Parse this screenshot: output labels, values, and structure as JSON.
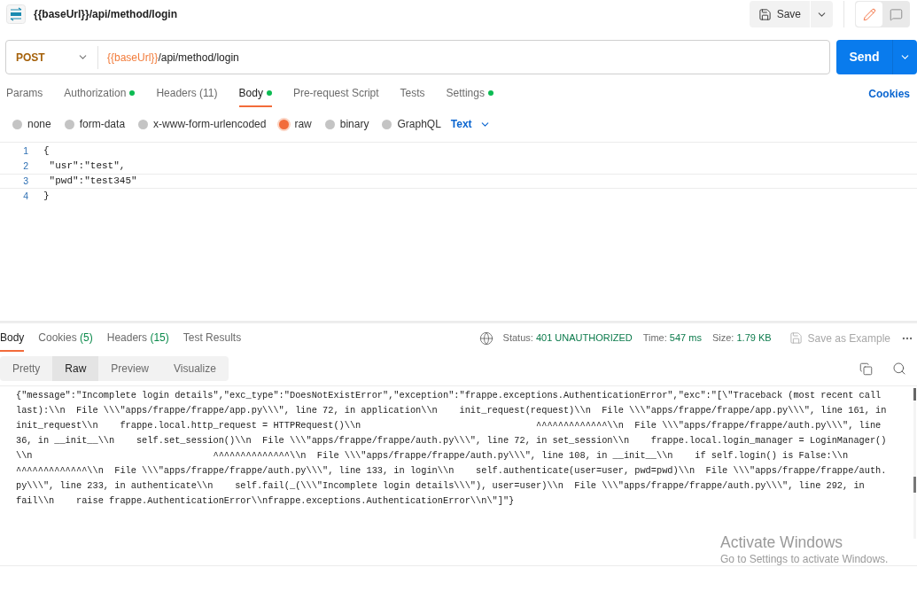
{
  "header": {
    "title": "{{baseUrl}}/api/method/login",
    "save_label": "Save",
    "modes": [
      {
        "kind": "edit",
        "selected": true
      },
      {
        "kind": "comments",
        "selected": false
      }
    ]
  },
  "request": {
    "method": "POST",
    "url_variable": "{{baseUrl}}",
    "url_path": "/api/method/login",
    "send_label": "Send"
  },
  "request_tabs": [
    {
      "label": "Params",
      "selected": false,
      "dot": false
    },
    {
      "label": "Authorization",
      "selected": false,
      "dot": true
    },
    {
      "label": "Headers (11)",
      "selected": false,
      "dot": false
    },
    {
      "label": "Body",
      "selected": true,
      "dot": true
    },
    {
      "label": "Pre-request Script",
      "selected": false,
      "dot": false
    },
    {
      "label": "Tests",
      "selected": false,
      "dot": false
    },
    {
      "label": "Settings",
      "selected": false,
      "dot": true
    }
  ],
  "cookies_link": "Cookies",
  "body_types": [
    {
      "label": "none",
      "selected": false
    },
    {
      "label": "form-data",
      "selected": false
    },
    {
      "label": "x-www-form-urlencoded",
      "selected": false
    },
    {
      "label": "raw",
      "selected": true
    },
    {
      "label": "binary",
      "selected": false
    },
    {
      "label": "GraphQL",
      "selected": false
    }
  ],
  "raw_format": "Text",
  "editor": {
    "lines": [
      {
        "number": "1",
        "text": "{"
      },
      {
        "number": "2",
        "text": " \"usr\":\"test\","
      },
      {
        "number": "3",
        "text": " \"pwd\":\"test345\""
      },
      {
        "number": "4",
        "text": "}"
      }
    ]
  },
  "response_tabs": [
    {
      "label": "Body",
      "selected": true
    },
    {
      "label": "Cookies",
      "count": "(5)",
      "selected": false
    },
    {
      "label": "Headers",
      "count": "(15)",
      "selected": false
    },
    {
      "label": "Test Results",
      "selected": false
    }
  ],
  "status": {
    "status_label": "Status:",
    "status_value": "401 UNAUTHORIZED",
    "time_label": "Time:",
    "time_value": "547 ms",
    "size_label": "Size:",
    "size_value": "1.79 KB",
    "save_example": "Save as Example"
  },
  "view_tabs": [
    {
      "label": "Pretty",
      "selected": false
    },
    {
      "label": "Raw",
      "selected": true
    },
    {
      "label": "Preview",
      "selected": false
    },
    {
      "label": "Visualize",
      "selected": false
    }
  ],
  "response_body": [
    "{\"message\":\"Incomplete login details\",\"exc_type\":\"DoesNotExistError\",\"exception\":\"frappe.exceptions.AuthenticationError\",\"exc\":\"[\\\"Traceback (most recent call",
    "last):\\\\n  File \\\\\\\"apps/frappe/frappe/app.py\\\\\\\", line 72, in application\\\\n    init_request(request)\\\\n  File \\\\\\\"apps/frappe/frappe/app.py\\\\\\\", line 161, in",
    "init_request\\\\n    frappe.local.http_request = HTTPRequest()\\\\n                                ^^^^^^^^^^^^^\\\\n  File \\\\\\\"apps/frappe/frappe/auth.py\\\\\\\", line",
    "36, in __init__\\\\n    self.set_session()\\\\n  File \\\\\\\"apps/frappe/frappe/auth.py\\\\\\\", line 72, in set_session\\\\n    frappe.local.login_manager = LoginManager()",
    "\\\\n                                 ^^^^^^^^^^^^^^\\\\n  File \\\\\\\"apps/frappe/frappe/auth.py\\\\\\\", line 108, in __init__\\\\n    if self.login() is False:\\\\n",
    "^^^^^^^^^^^^^\\\\n  File \\\\\\\"apps/frappe/frappe/auth.py\\\\\\\", line 133, in login\\\\n    self.authenticate(user=user, pwd=pwd)\\\\n  File \\\\\\\"apps/frappe/frappe/auth.",
    "py\\\\\\\", line 233, in authenticate\\\\n    self.fail(_(\\\\\\\"Incomplete login details\\\\\\\"), user=user)\\\\n  File \\\\\\\"apps/frappe/frappe/auth.py\\\\\\\", line 292, in",
    "fail\\\\n    raise frappe.AuthenticationError\\\\nfrappe.exceptions.AuthenticationError\\\\n\\\"]\"}"
  ],
  "os_overlay": {
    "title": "Activate Windows",
    "subtitle": "Go to Settings to activate Windows."
  }
}
